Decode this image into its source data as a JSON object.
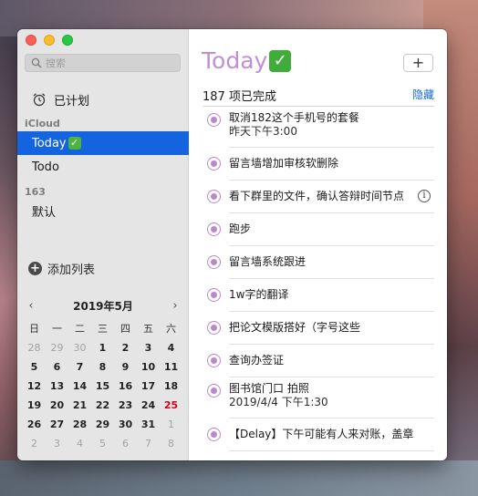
{
  "sidebar": {
    "search_placeholder": "搜索",
    "scheduled_label": "已计划",
    "sections": [
      {
        "label": "iCloud",
        "items": [
          "Today",
          "Todo"
        ]
      },
      {
        "label": "163",
        "items": [
          "默认"
        ]
      }
    ],
    "selected_item": "Today",
    "add_list_label": "添加列表"
  },
  "calendar": {
    "title": "2019年5月",
    "prev_icon": "chevron-left-icon",
    "next_icon": "chevron-right-icon",
    "weekdays": [
      "日",
      "一",
      "二",
      "三",
      "四",
      "五",
      "六"
    ],
    "weeks": [
      [
        "28",
        "29",
        "30",
        "1",
        "2",
        "3",
        "4"
      ],
      [
        "5",
        "6",
        "7",
        "8",
        "9",
        "10",
        "11"
      ],
      [
        "12",
        "13",
        "14",
        "15",
        "16",
        "17",
        "18"
      ],
      [
        "19",
        "20",
        "21",
        "22",
        "23",
        "24",
        "25"
      ],
      [
        "26",
        "27",
        "28",
        "29",
        "30",
        "31",
        "1"
      ],
      [
        "2",
        "3",
        "4",
        "5",
        "6",
        "7",
        "8"
      ]
    ],
    "today": "25"
  },
  "main": {
    "title": "Today",
    "add_button": "+",
    "summary_count": "187",
    "summary_label": "项已完成",
    "hide_label": "隐藏",
    "accent_color": "#c28ed6",
    "reminders": [
      {
        "title": "取消182这个手机号的套餐",
        "subtitle": "昨天下午3:00"
      },
      {
        "title": "留言墙增加审核软删除",
        "subtitle": ""
      },
      {
        "title": "看下群里的文件，确认答辩时间节点",
        "subtitle": "",
        "info": "i"
      },
      {
        "title": "跑步",
        "subtitle": ""
      },
      {
        "title": "留言墙系统跟进",
        "subtitle": ""
      },
      {
        "title": "1w字的翻译",
        "subtitle": ""
      },
      {
        "title": "把论文模版搭好（字号这些",
        "subtitle": ""
      },
      {
        "title": "查询办签证",
        "subtitle": ""
      },
      {
        "title": "图书馆门口 拍照",
        "subtitle": "2019/4/4 下午1:30"
      },
      {
        "title": "【Delay】下午可能有人来对账，盖章",
        "subtitle": ""
      },
      {
        "title": "",
        "subtitle": ""
      }
    ]
  }
}
